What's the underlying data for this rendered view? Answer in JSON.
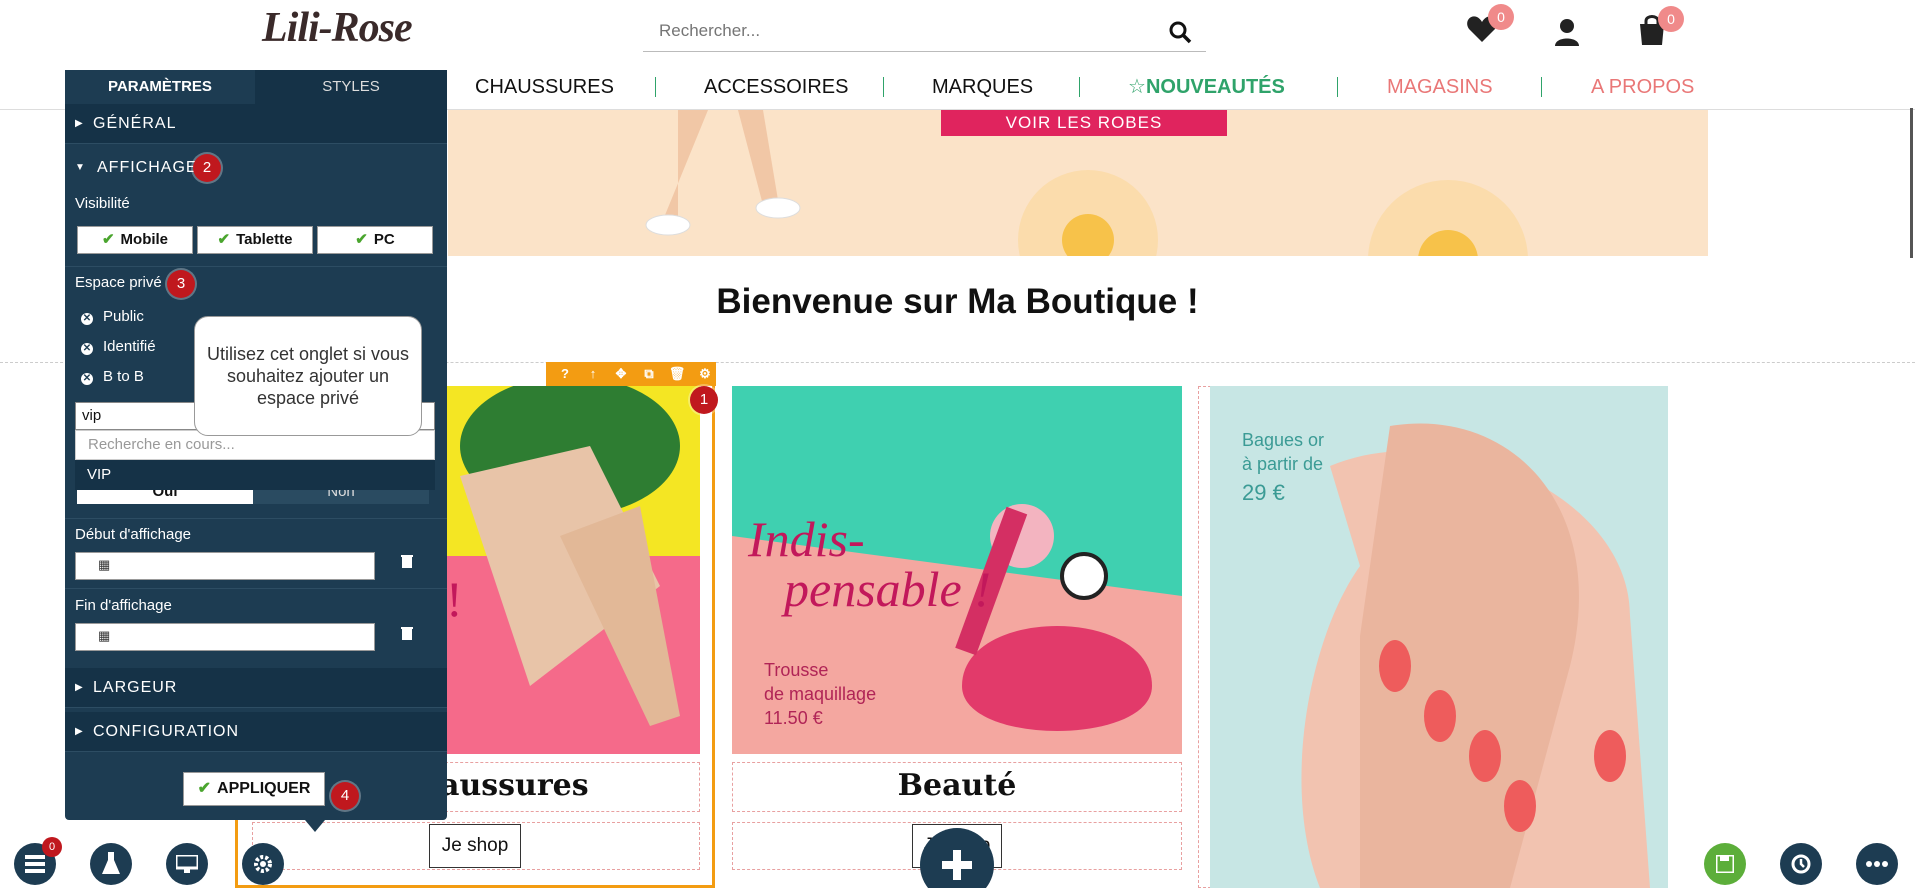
{
  "header": {
    "logo": "Lili-Rose",
    "search_placeholder": "Rechercher...",
    "wishlist_count": "0",
    "cart_count": "0"
  },
  "nav": {
    "items": [
      "CHAUSSURES",
      "ACCESSOIRES",
      "MARQUES",
      "NOUVEAUTÉS",
      "MAGASINS",
      "A PROPOS"
    ]
  },
  "banner": {
    "button": "VOIR LES ROBES"
  },
  "main": {
    "welcome": "Bienvenue sur Ma Boutique !"
  },
  "products": [
    {
      "title": "aussures",
      "button": "Je shop"
    },
    {
      "title": "Beauté",
      "button": "Je shop",
      "promo_line1": "Indis-",
      "promo_line2": "pensable !",
      "note": "Trousse\nde maquillage\n11.50 €"
    },
    {
      "note": "Bagues or\nà partir de\n29 €"
    }
  ],
  "toolbar": {
    "icons": [
      "?",
      "↑",
      "✥",
      "⧉",
      "🗑",
      "⚙"
    ]
  },
  "panel": {
    "tabs": [
      "PARAMÈTRES",
      "STYLES"
    ],
    "sections": {
      "general": "GÉNÉRAL",
      "affichage": "AFFICHAGE",
      "largeur": "LARGEUR",
      "configuration": "CONFIGURATION"
    },
    "visibility_label": "Visibilité",
    "visibility_buttons": [
      "Mobile",
      "Tablette",
      "PC"
    ],
    "private_label": "Espace privé",
    "private_options": [
      "Public",
      "Identifié",
      "B to B"
    ],
    "search_value": "vip",
    "search_status": "Recherche en cours...",
    "search_result": "VIP",
    "toggle": [
      "Oui",
      "Non"
    ],
    "start_label": "Début d'affichage",
    "end_label": "Fin d'affichage",
    "apply": "APPLIQUER"
  },
  "tooltip": "Utilisez cet onglet si vous souhaitez ajouter un espace privé",
  "step_badges": [
    "1",
    "2",
    "3",
    "4"
  ],
  "bottom": {
    "layers_count": "0"
  },
  "colors": {
    "panel": "#1d3c52",
    "section": "#153247",
    "accent": "#f39c12",
    "badge": "#c0181e",
    "nav_new": "#2fa36a",
    "nav_pink": "#e97777"
  }
}
